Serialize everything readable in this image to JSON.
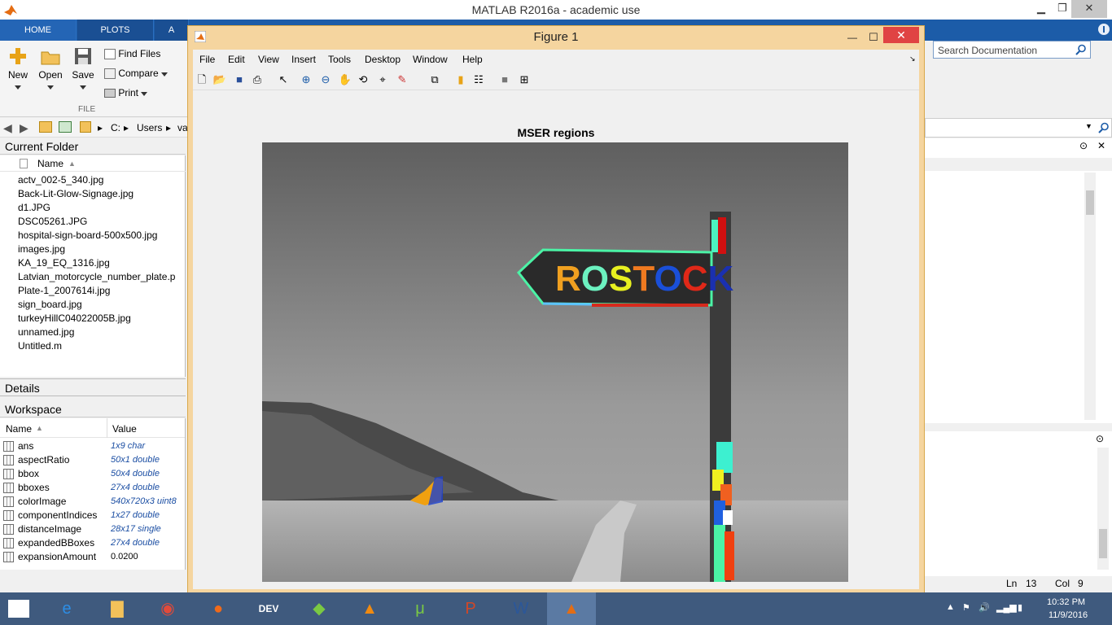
{
  "app": {
    "title": "MATLAB R2016a - academic use",
    "win_min": "▁",
    "win_max": "❐",
    "win_close": "✕"
  },
  "ribbon": {
    "tabs": [
      "HOME",
      "PLOTS",
      "A"
    ],
    "search_placeholder": "Search Documentation",
    "buttons": {
      "new": "New",
      "open": "Open",
      "save": "Save",
      "find_files": "Find Files",
      "compare": "Compare",
      "print": "Print"
    },
    "section": "FILE"
  },
  "address": {
    "path": [
      "C:",
      "Users",
      "va"
    ]
  },
  "current_folder": {
    "title": "Current Folder",
    "col_name": "Name",
    "files": [
      {
        "name": "actv_002-5_340.jpg",
        "type": "image"
      },
      {
        "name": "Back-Lit-Glow-Signage.jpg",
        "type": "image"
      },
      {
        "name": "d1.JPG",
        "type": "image"
      },
      {
        "name": "DSC05261.JPG",
        "type": "image"
      },
      {
        "name": "hospital-sign-board-500x500.jpg",
        "type": "image"
      },
      {
        "name": "images.jpg",
        "type": "image"
      },
      {
        "name": "KA_19_EQ_1316.jpg",
        "type": "image"
      },
      {
        "name": "Latvian_motorcycle_number_plate.p",
        "type": "doc"
      },
      {
        "name": "Plate-1_2007614i.jpg",
        "type": "image"
      },
      {
        "name": "sign_board.jpg",
        "type": "image"
      },
      {
        "name": "turkeyHillC04022005B.jpg",
        "type": "image"
      },
      {
        "name": "unnamed.jpg",
        "type": "image"
      },
      {
        "name": "Untitled.m",
        "type": "mfile"
      }
    ]
  },
  "details": {
    "title": "Details"
  },
  "workspace": {
    "title": "Workspace",
    "col_name": "Name",
    "col_value": "Value",
    "vars": [
      {
        "name": "ans",
        "value": "1x9 char"
      },
      {
        "name": "aspectRatio",
        "value": "50x1 double"
      },
      {
        "name": "bbox",
        "value": "50x4 double"
      },
      {
        "name": "bboxes",
        "value": "27x4 double"
      },
      {
        "name": "colorImage",
        "value": "540x720x3 uint8"
      },
      {
        "name": "componentIndices",
        "value": "1x27 double"
      },
      {
        "name": "distanceImage",
        "value": "28x17 single"
      },
      {
        "name": "expandedBBoxes",
        "value": "27x4 double"
      },
      {
        "name": "expansionAmount",
        "value": "0.0200"
      }
    ]
  },
  "status": {
    "ln_label": "Ln",
    "ln": "13",
    "col_label": "Col",
    "col": "9"
  },
  "figure": {
    "title": "Figure 1",
    "menu": [
      "File",
      "Edit",
      "View",
      "Insert",
      "Tools",
      "Desktop",
      "Window",
      "Help"
    ],
    "plot_title": "MSER regions",
    "sign_text": "ROSTOCK",
    "win_min": "—",
    "win_max": "☐",
    "win_close": "✕"
  },
  "taskbar": {
    "time": "10:32 PM",
    "date": "11/9/2016"
  },
  "colors": {
    "ribbon_blue": "#1c5ca8",
    "figure_border": "#f5d59f",
    "close_red": "#e04343",
    "taskbar": "#3f5a7e"
  }
}
